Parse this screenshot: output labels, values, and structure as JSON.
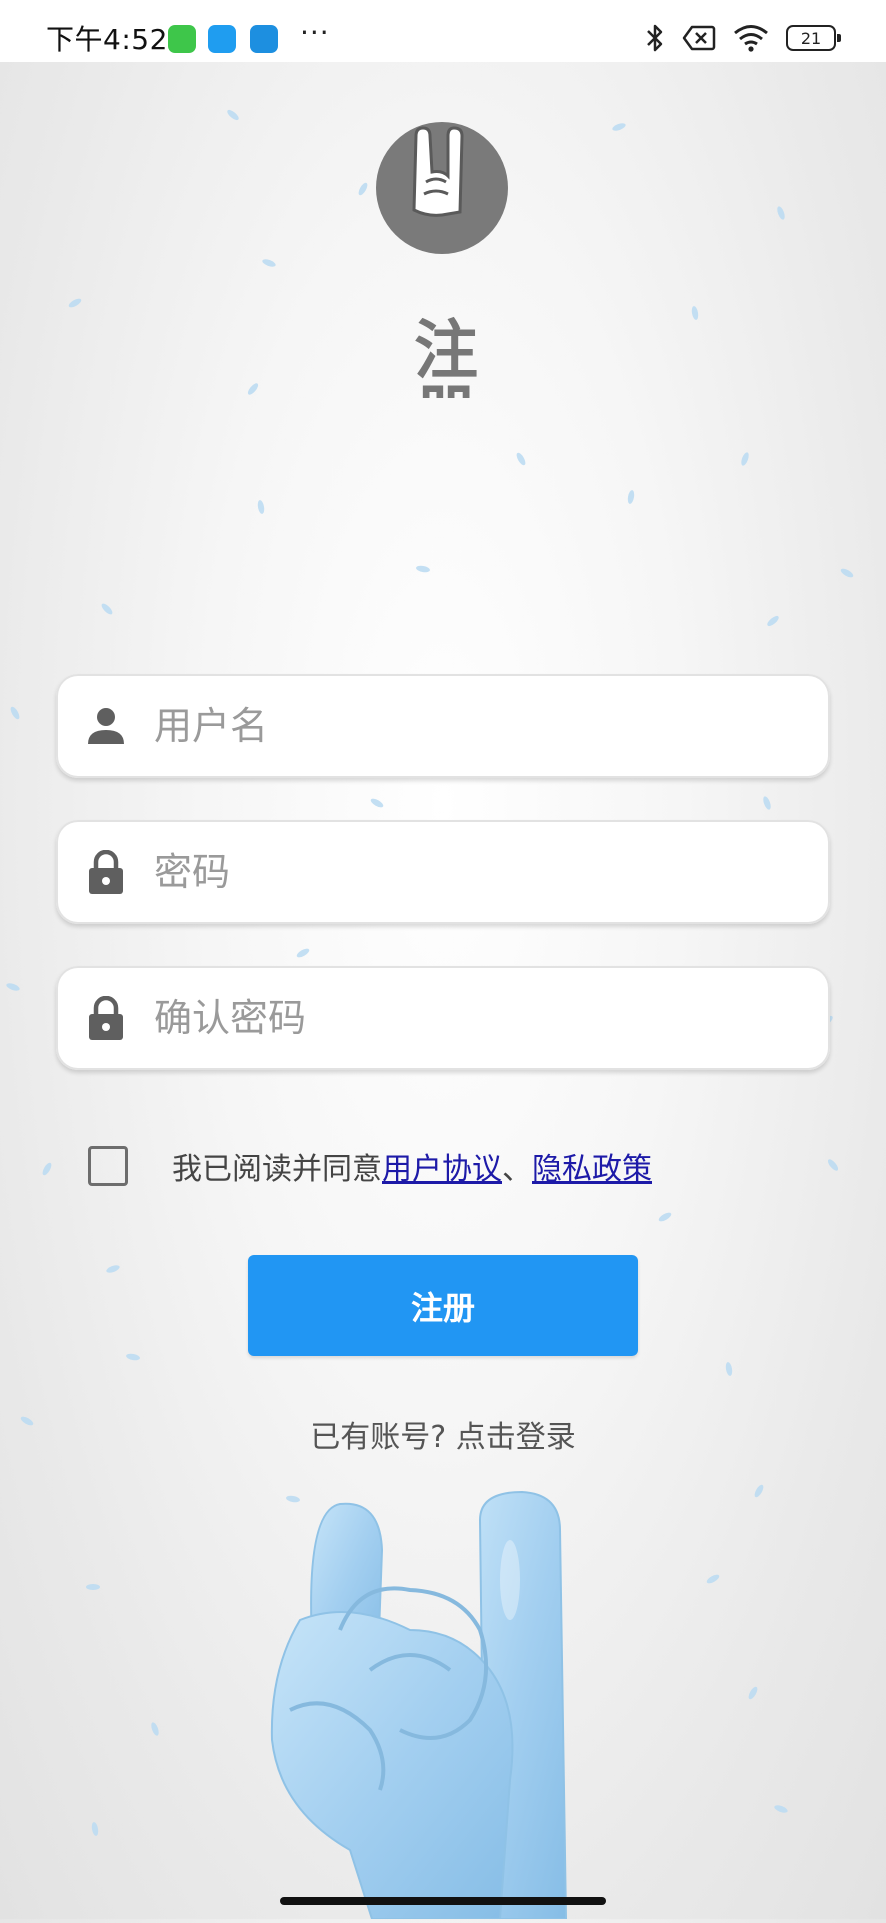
{
  "status_bar": {
    "time": "下午4:52",
    "more": "···",
    "battery": "21",
    "icons": [
      "green-app-icon",
      "blue-chat-icon",
      "n-app-icon",
      "bluetooth-icon",
      "no-sim-icon",
      "wifi-icon",
      "battery-icon"
    ]
  },
  "logo": {
    "text": "注册",
    "icon": "rock-hand-logo-icon"
  },
  "form": {
    "username_placeholder": "用户名",
    "password_placeholder": "密码",
    "confirm_placeholder": "确认密码",
    "icons": [
      "user-icon",
      "lock-icon",
      "lock-icon"
    ]
  },
  "agreement": {
    "prefix": "我已阅读并同意",
    "user_agreement": "用户协议",
    "separator": "、",
    "privacy_policy": "隐私政策",
    "checked": false
  },
  "register_button": "注册",
  "login_prompt": "已有账号? 点击登录",
  "colors": {
    "accent": "#2196f3",
    "link": "#1d1aa8",
    "hand": "#a8d4f2"
  }
}
